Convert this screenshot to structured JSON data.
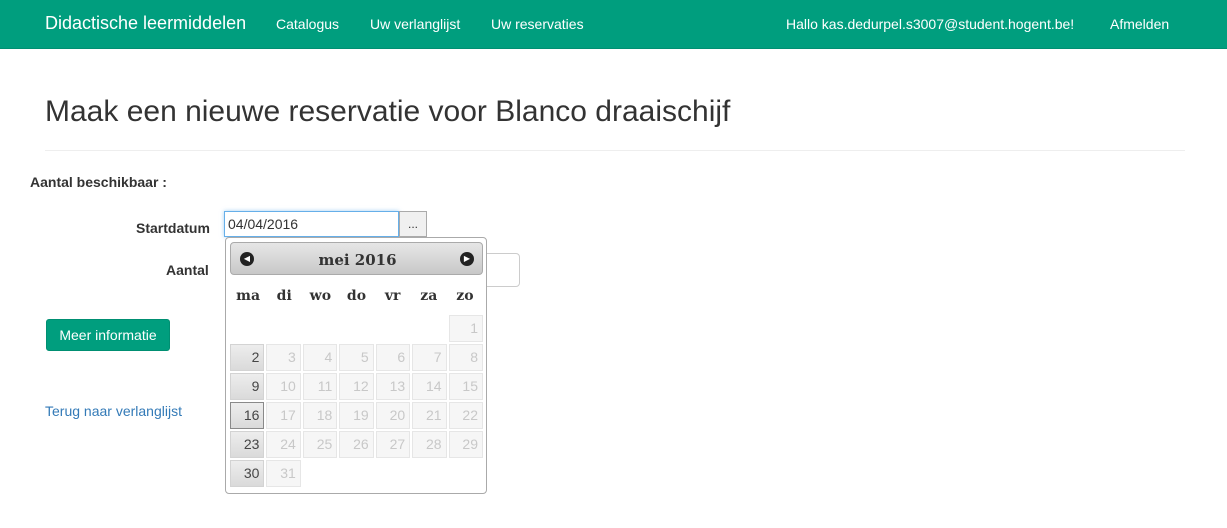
{
  "nav": {
    "brand": "Didactische leermiddelen",
    "links": [
      "Catalogus",
      "Uw verlanglijst",
      "Uw reservaties"
    ],
    "greeting": "Hallo kas.dedurpel.s3007@student.hogent.be!",
    "logout": "Afmelden"
  },
  "page": {
    "title": "Maak een nieuwe reservatie voor Blanco draaischijf"
  },
  "form": {
    "available_label": "Aantal beschikbaar :",
    "start_label": "Startdatum",
    "start_value": "04/04/2016",
    "trigger_label": "...",
    "amount_label": "Aantal",
    "more_info_button": "Meer informatie",
    "back_link": "Terug naar verlanglijst"
  },
  "datepicker": {
    "title": "mei 2016",
    "weekdays": [
      "ma",
      "di",
      "wo",
      "do",
      "vr",
      "za",
      "zo"
    ],
    "leading_blanks": 6,
    "days_in_month": 31,
    "enabled_days": [
      2,
      9,
      16,
      23,
      30
    ],
    "active_day": 16
  },
  "colors": {
    "navbar": "#009e7e",
    "link": "#337ab7"
  }
}
